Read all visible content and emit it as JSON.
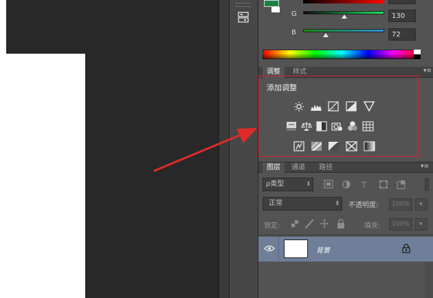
{
  "color_panel": {
    "g_label": "G",
    "b_label": "B",
    "g_value": "130",
    "b_value": "72",
    "g_level": 0.51,
    "b_level": 0.28,
    "fg_color": "#1a8248",
    "bg_color": "#ffffff"
  },
  "adjust_panel": {
    "tabs": [
      {
        "label": "调整",
        "active": true
      },
      {
        "label": "样式",
        "active": false
      }
    ],
    "title": "添加调整"
  },
  "layers_panel": {
    "tabs": [
      {
        "label": "图层",
        "active": true
      },
      {
        "label": "通道",
        "active": false
      },
      {
        "label": "路径",
        "active": false
      }
    ],
    "filter_label": "ρ类型",
    "blend_mode": "正常",
    "opacity_label": "不透明度:",
    "opacity_value": "100%",
    "lock_label": "锁定:",
    "fill_label": "填充:",
    "fill_value": "100%",
    "layer": {
      "name": "背景"
    }
  },
  "colors": {
    "highlight": "#d9252b",
    "arrow": "#e02a2a",
    "selected_layer": "#6f7f9a"
  }
}
